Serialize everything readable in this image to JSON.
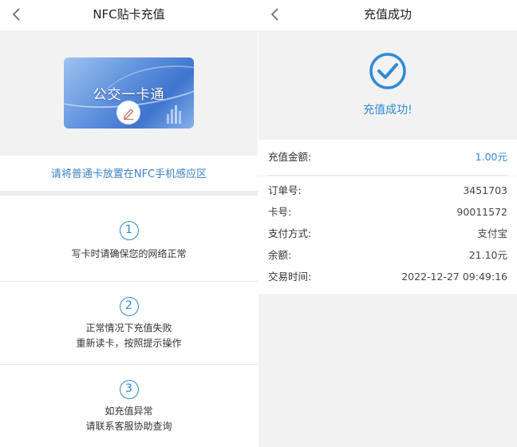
{
  "left_screen": {
    "title": "NFC贴卡充值",
    "card_name": "公交一卡通",
    "hint": "请将普通卡放置在NFC手机感应区",
    "steps": [
      {
        "number": "1",
        "lines": [
          "写卡时请确保您的网络正常"
        ]
      },
      {
        "number": "2",
        "lines": [
          "正常情况下充值失败",
          "重新读卡，按照提示操作"
        ]
      },
      {
        "number": "3",
        "lines": [
          "如充值异常",
          "请联系客服协助查询"
        ]
      }
    ]
  },
  "right_screen": {
    "title": "充值成功",
    "success_text": "充值成功!",
    "amount": {
      "label": "充值金额:",
      "value": "1.00元"
    },
    "details": [
      {
        "label": "订单号:",
        "value": "3451703"
      },
      {
        "label": "卡号:",
        "value": "90011572"
      },
      {
        "label": "支付方式:",
        "value": "支付宝"
      },
      {
        "label": "余额:",
        "value": "21.10元"
      },
      {
        "label": "交易时间:",
        "value": "2022-12-27 09:49:16"
      }
    ]
  },
  "colors": {
    "accent": "#2f8ad6",
    "hint_text": "#3b82c4",
    "background": "#f2f2f2"
  },
  "icons": [
    "back-arrow-icon",
    "pen-icon",
    "check-circle-icon"
  ]
}
